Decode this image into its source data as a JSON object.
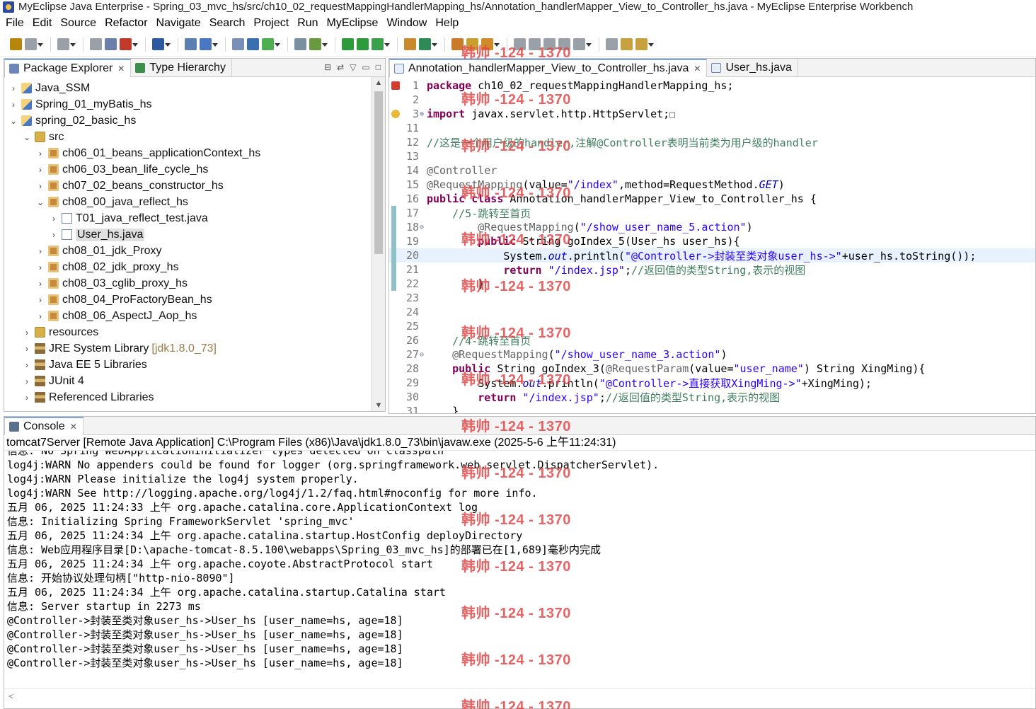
{
  "window": {
    "title": "MyEclipse Java Enterprise - Spring_03_mvc_hs/src/ch10_02_requestMappingHandlerMapping_hs/Annotation_handlerMapper_View_to_Controller_hs.java - MyEclipse Enterprise Workbench"
  },
  "menu": [
    "File",
    "Edit",
    "Source",
    "Refactor",
    "Navigate",
    "Search",
    "Project",
    "Run",
    "MyEclipse",
    "Window",
    "Help"
  ],
  "toolbar_colors": [
    "#b8860b",
    "#9aa0a8",
    "#9aa0a8",
    "#9aa0a8",
    "#6b7fa8",
    "#c0392b",
    "#2c5aa0",
    "#5a7fb0",
    "#4a77c2",
    "#7a8fb5",
    "#3a6fb0",
    "#4caf50",
    "#7a8fa0",
    "#6a9a40",
    "#2d9b3a",
    "#2d9b3a",
    "#3aa04a",
    "#c88a2a",
    "#2e8b57",
    "#c97b2a",
    "#c9a030",
    "#d08a2a",
    "#9aa0a8",
    "#9aa0a8",
    "#9aa0a8",
    "#9aa0a8",
    "#9aa0a8",
    "#9aa0a8",
    "#c8a040",
    "#c8a040",
    "#9aa0a8"
  ],
  "explorer": {
    "tabs": [
      {
        "label": "Package Explorer",
        "icon": "package-explorer-icon"
      },
      {
        "label": "Type Hierarchy",
        "icon": "type-hierarchy-icon"
      }
    ],
    "tree": [
      {
        "label": "Java_SSM",
        "depth": 0,
        "expand": "right",
        "icon": "project",
        "extra": ""
      },
      {
        "label": "Spring_01_myBatis_hs",
        "depth": 0,
        "expand": "right",
        "icon": "project",
        "extra": ""
      },
      {
        "label": "spring_02_basic_hs",
        "depth": 0,
        "expand": "down",
        "icon": "project",
        "extra": ""
      },
      {
        "label": "src",
        "depth": 1,
        "expand": "down",
        "icon": "srcfolder",
        "extra": ""
      },
      {
        "label": "ch06_01_beans_applicationContext_hs",
        "depth": 2,
        "expand": "right",
        "icon": "package",
        "extra": ""
      },
      {
        "label": "ch06_03_bean_life_cycle_hs",
        "depth": 2,
        "expand": "right",
        "icon": "package",
        "extra": ""
      },
      {
        "label": "ch07_02_beans_constructor_hs",
        "depth": 2,
        "expand": "right",
        "icon": "package",
        "extra": ""
      },
      {
        "label": "ch08_00_java_reflect_hs",
        "depth": 2,
        "expand": "down",
        "icon": "package",
        "extra": ""
      },
      {
        "label": "T01_java_reflect_test.java",
        "depth": 3,
        "expand": "right",
        "icon": "java",
        "extra": ""
      },
      {
        "label": "User_hs.java",
        "depth": 3,
        "expand": "right",
        "icon": "java",
        "extra": "",
        "selected": true
      },
      {
        "label": "ch08_01_jdk_Proxy",
        "depth": 2,
        "expand": "right",
        "icon": "package",
        "extra": ""
      },
      {
        "label": "ch08_02_jdk_proxy_hs",
        "depth": 2,
        "expand": "right",
        "icon": "package",
        "extra": ""
      },
      {
        "label": "ch08_03_cglib_proxy_hs",
        "depth": 2,
        "expand": "right",
        "icon": "package",
        "extra": ""
      },
      {
        "label": "ch08_04_ProFactoryBean_hs",
        "depth": 2,
        "expand": "right",
        "icon": "package",
        "extra": ""
      },
      {
        "label": "ch08_06_AspectJ_Aop_hs",
        "depth": 2,
        "expand": "right",
        "icon": "package",
        "extra": ""
      },
      {
        "label": "resources",
        "depth": 1,
        "expand": "right",
        "icon": "srcfolder",
        "extra": ""
      },
      {
        "label": "JRE System Library",
        "depth": 1,
        "expand": "right",
        "icon": "lib",
        "extra": "[jdk1.8.0_73]"
      },
      {
        "label": "Java EE 5 Libraries",
        "depth": 1,
        "expand": "right",
        "icon": "lib",
        "extra": ""
      },
      {
        "label": "JUnit 4",
        "depth": 1,
        "expand": "right",
        "icon": "lib",
        "extra": ""
      },
      {
        "label": "Referenced Libraries",
        "depth": 1,
        "expand": "right",
        "icon": "lib",
        "extra": ""
      }
    ]
  },
  "editor": {
    "tabs": [
      {
        "label": "Annotation_handlerMapper_View_to_Controller_hs.java",
        "active": true
      },
      {
        "label": "User_hs.java",
        "active": false
      }
    ],
    "lines": [
      {
        "n": "1",
        "marker": "err",
        "fold": "",
        "segs": [
          [
            "package ",
            "kw"
          ],
          [
            "ch10_02_requestMappingHandlerMapping_hs;",
            ""
          ]
        ]
      },
      {
        "n": "2",
        "marker": "",
        "fold": "",
        "segs": []
      },
      {
        "n": "3",
        "marker": "warn",
        "fold": "⊕",
        "segs": [
          [
            "import ",
            "kw"
          ],
          [
            "javax.servlet.http.HttpServlet;",
            ""
          ],
          [
            "□",
            "box"
          ]
        ]
      },
      {
        "n": "11",
        "marker": "",
        "fold": "",
        "segs": []
      },
      {
        "n": "12",
        "marker": "",
        "fold": "",
        "segs": [
          [
            "//这是一个用户级的handler,注解@Controller表明当前类为用户级的handler",
            "cm"
          ]
        ]
      },
      {
        "n": "13",
        "marker": "",
        "fold": "",
        "segs": []
      },
      {
        "n": "14",
        "marker": "",
        "fold": "",
        "segs": [
          [
            "@Controller",
            "an"
          ]
        ]
      },
      {
        "n": "15",
        "marker": "",
        "fold": "",
        "segs": [
          [
            "@RequestMapping",
            "an"
          ],
          [
            "(value=",
            ""
          ],
          [
            "\"/index\"",
            "st"
          ],
          [
            ",method=RequestMethod.",
            ""
          ],
          [
            "GET",
            "sf"
          ],
          [
            ")",
            ""
          ]
        ]
      },
      {
        "n": "16",
        "marker": "",
        "fold": "",
        "segs": [
          [
            "public class ",
            "kw"
          ],
          [
            "Annotation_handlerMapper_View_to_Controller_hs {",
            ""
          ]
        ]
      },
      {
        "n": "17",
        "marker": "bar",
        "fold": "",
        "segs": [
          [
            "    //5-跳转至首页",
            "cm"
          ]
        ]
      },
      {
        "n": "18",
        "marker": "bar",
        "fold": "⊖",
        "segs": [
          [
            "        ",
            ""
          ],
          [
            "@RequestMapping",
            "an"
          ],
          [
            "(",
            ""
          ],
          [
            "\"/show_user_name_5.action\"",
            "st"
          ],
          [
            ")",
            ""
          ]
        ]
      },
      {
        "n": "19",
        "marker": "bar",
        "fold": "",
        "segs": [
          [
            "        ",
            ""
          ],
          [
            "public ",
            "kw"
          ],
          [
            "String goIndex_5(User_hs user_hs){",
            ""
          ]
        ]
      },
      {
        "n": "20",
        "marker": "bar",
        "fold": "",
        "cur": true,
        "segs": [
          [
            "            System.",
            ""
          ],
          [
            "out",
            "sf"
          ],
          [
            ".println(",
            ""
          ],
          [
            "\"@Controller->封装至类对象user_hs->\"",
            "st"
          ],
          [
            "+user_hs.toString());",
            ""
          ]
        ]
      },
      {
        "n": "21",
        "marker": "bar",
        "fold": "",
        "segs": [
          [
            "            ",
            ""
          ],
          [
            "return ",
            "kw"
          ],
          [
            "\"/index.jsp\"",
            "st"
          ],
          [
            ";",
            ""
          ],
          [
            "//返回值的类型String,表示的视图",
            "cm"
          ]
        ]
      },
      {
        "n": "22",
        "marker": "bar",
        "fold": "",
        "segs": [
          [
            "        }",
            ""
          ]
        ]
      },
      {
        "n": "23",
        "marker": "",
        "fold": "",
        "segs": []
      },
      {
        "n": "24",
        "marker": "",
        "fold": "",
        "segs": []
      },
      {
        "n": "25",
        "marker": "",
        "fold": "",
        "segs": []
      },
      {
        "n": "26",
        "marker": "",
        "fold": "",
        "segs": [
          [
            "    //4-跳转至首页",
            "cm"
          ]
        ]
      },
      {
        "n": "27",
        "marker": "",
        "fold": "⊖",
        "segs": [
          [
            "    ",
            ""
          ],
          [
            "@RequestMapping",
            "an"
          ],
          [
            "(",
            ""
          ],
          [
            "\"/show_user_name_3.action\"",
            "st"
          ],
          [
            ")",
            ""
          ]
        ]
      },
      {
        "n": "28",
        "marker": "",
        "fold": "",
        "segs": [
          [
            "    ",
            ""
          ],
          [
            "public ",
            "kw"
          ],
          [
            "String goIndex_3(",
            ""
          ],
          [
            "@RequestParam",
            "an"
          ],
          [
            "(value=",
            ""
          ],
          [
            "\"user_name\"",
            "st"
          ],
          [
            ") String XingMing){",
            ""
          ]
        ]
      },
      {
        "n": "29",
        "marker": "",
        "fold": "",
        "segs": [
          [
            "        System.",
            ""
          ],
          [
            "out",
            "sf"
          ],
          [
            ".println(",
            ""
          ],
          [
            "\"@Controller->直接获取XingMing->\"",
            "st"
          ],
          [
            "+XingMing);",
            ""
          ]
        ]
      },
      {
        "n": "30",
        "marker": "",
        "fold": "",
        "segs": [
          [
            "        ",
            ""
          ],
          [
            "return ",
            "kw"
          ],
          [
            "\"/index.jsp\"",
            "st"
          ],
          [
            ";",
            ""
          ],
          [
            "//返回值的类型String,表示的视图",
            "cm"
          ]
        ]
      },
      {
        "n": "31",
        "marker": "",
        "fold": "",
        "segs": [
          [
            "    }",
            ""
          ]
        ]
      }
    ]
  },
  "console": {
    "tab": "Console",
    "title": "tomcat7Server [Remote Java Application] C:\\Program Files (x86)\\Java\\jdk1.8.0_73\\bin\\javaw.exe (2025-5-6 上午11:24:31)",
    "lines": [
      "信息: No Spring WebApplicationInitializer types detected on classpath",
      "log4j:WARN No appenders could be found for logger (org.springframework.web.servlet.DispatcherServlet).",
      "log4j:WARN Please initialize the log4j system properly.",
      "log4j:WARN See http://logging.apache.org/log4j/1.2/faq.html#noconfig for more info.",
      "五月 06, 2025 11:24:33 上午 org.apache.catalina.core.ApplicationContext log",
      "信息: Initializing Spring FrameworkServlet 'spring_mvc'",
      "五月 06, 2025 11:24:34 上午 org.apache.catalina.startup.HostConfig deployDirectory",
      "信息: Web应用程序目录[D:\\apache-tomcat-8.5.100\\webapps\\Spring_03_mvc_hs]的部署已在[1,689]毫秒内完成",
      "五月 06, 2025 11:24:34 上午 org.apache.coyote.AbstractProtocol start",
      "信息: 开始协议处理句柄[\"http-nio-8090\"]",
      "五月 06, 2025 11:24:34 上午 org.apache.catalina.startup.Catalina start",
      "信息: Server startup in 2273 ms",
      "@Controller->封装至类对象user_hs->User_hs [user_name=hs, age=18]",
      "@Controller->封装至类对象user_hs->User_hs [user_name=hs, age=18]",
      "@Controller->封装至类对象user_hs->User_hs [user_name=hs, age=18]",
      "@Controller->封装至类对象user_hs->User_hs [user_name=hs, age=18]"
    ]
  },
  "watermark": {
    "text": "韩帅 -124 - 1370"
  },
  "colors": {
    "keyword": "#7f0055",
    "string": "#2a00ff",
    "comment": "#3f7f5f",
    "annotation": "#646464",
    "static_field": "#0000c0",
    "watermark": "#e54848"
  }
}
